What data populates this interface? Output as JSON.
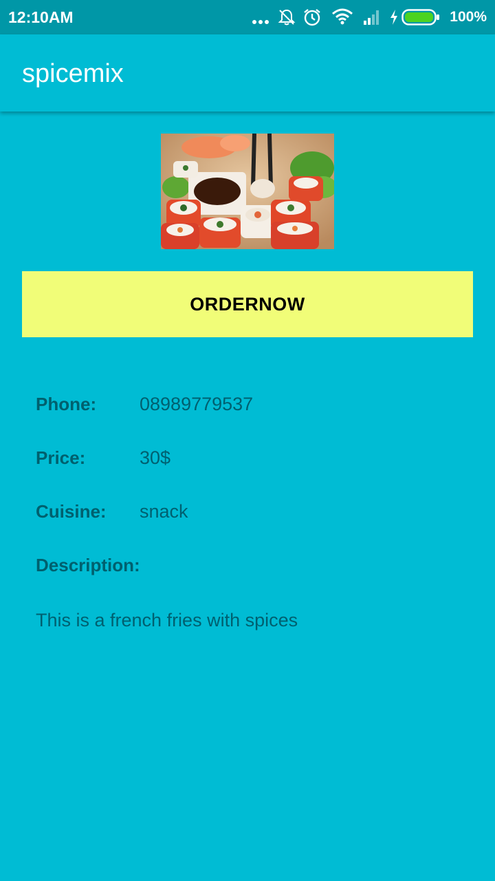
{
  "status_bar": {
    "time": "12:10AM",
    "battery": "100%",
    "icons": [
      "more-dots-icon",
      "notifications-off-icon",
      "alarm-icon",
      "wifi-icon",
      "signal-icon",
      "charging-icon",
      "battery-icon"
    ]
  },
  "app_bar": {
    "title": "spicemix"
  },
  "main": {
    "order_button_label": "ORDERNOW",
    "phone_label": "Phone:",
    "phone_value": "08989779537",
    "price_label": "Price:",
    "price_value": "30$",
    "cuisine_label": "Cuisine:",
    "cuisine_value": "snack",
    "description_label": "Description:",
    "description_value": "This is a french fries with spices"
  },
  "colors": {
    "primary": "#00BCD4",
    "primary_dark": "#0097A7",
    "button_bg": "#F1FD78",
    "detail_text": "#006070"
  }
}
